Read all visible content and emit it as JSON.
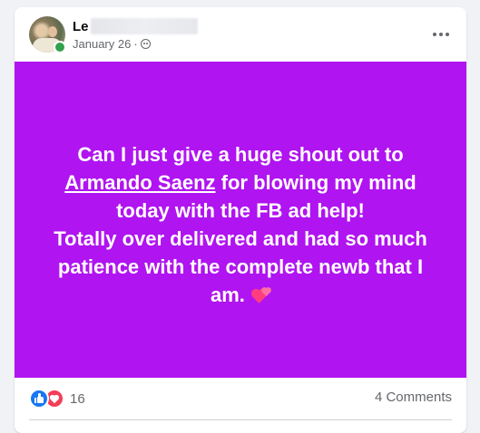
{
  "post": {
    "author_name_visible": "Le",
    "date": "January 26",
    "separator": "·",
    "audience": "friends-icon",
    "background_color": "#b014f0",
    "text": {
      "line_intro": "Can I just give a huge shout out to",
      "mention": "Armando Saenz",
      "after_mention": " for blowing my mind today with the FB ad help!",
      "line_two": "Totally over delivered and had so much patience with the complete newb that I am.",
      "emoji": "two-hearts-emoji"
    },
    "more_icon": "more-horizontal-icon"
  },
  "footer": {
    "reaction_icons": [
      "like-icon",
      "love-icon"
    ],
    "reaction_count": "16",
    "comments": "4 Comments"
  },
  "colors": {
    "like": "#1877f2",
    "love": "#f33e58",
    "online": "#31a24c",
    "secondary_text": "#65676b"
  }
}
